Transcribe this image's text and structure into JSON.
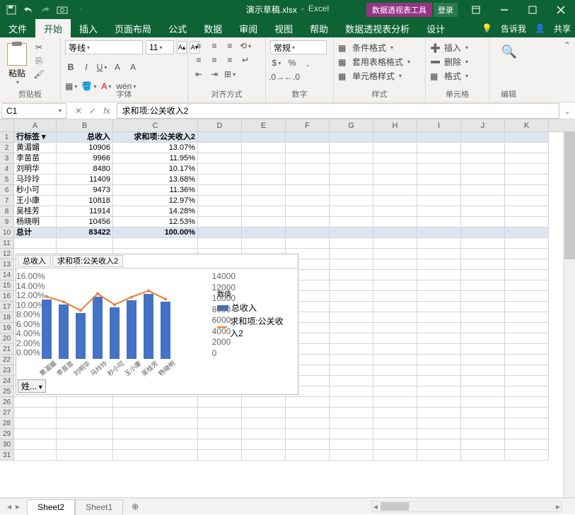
{
  "title": {
    "filename": "演示草稿.xlsx",
    "app": "Excel",
    "context_tool": "数据透视表工具",
    "login": "登录"
  },
  "tabs": {
    "file": "文件",
    "home": "开始",
    "insert": "插入",
    "layout": "页面布局",
    "formula": "公式",
    "data": "数据",
    "review": "审阅",
    "view": "视图",
    "help": "帮助",
    "pivot_analyze": "数据透视表分析",
    "design": "设计",
    "tell_me": "告诉我",
    "share": "共享"
  },
  "ribbon": {
    "clipboard": {
      "label": "剪贴板",
      "paste": "粘贴"
    },
    "font": {
      "label": "字体",
      "name": "等线",
      "size": "11"
    },
    "align": {
      "label": "对齐方式"
    },
    "number": {
      "label": "数字",
      "format": "常规"
    },
    "styles": {
      "label": "样式",
      "cond": "条件格式",
      "table": "套用表格格式",
      "cell": "单元格样式"
    },
    "cells": {
      "label": "单元格",
      "insert": "插入",
      "delete": "删除",
      "format": "格式"
    },
    "editing": {
      "label": "编辑"
    }
  },
  "formula_bar": {
    "cell_ref": "C1",
    "value": "求和项:公关收入2"
  },
  "columns": [
    "A",
    "B",
    "C",
    "D",
    "E",
    "F",
    "G",
    "H",
    "I",
    "J",
    "K"
  ],
  "pivot": {
    "headers": {
      "row": "行标签",
      "sum": "总收入",
      "calc": "求和项:公关收入2"
    },
    "rows": [
      {
        "name": "黄湄媚",
        "total": "10906",
        "pct": "13.07%"
      },
      {
        "name": "李苗苗",
        "total": "9966",
        "pct": "11.95%"
      },
      {
        "name": "刘明华",
        "total": "8480",
        "pct": "10.17%"
      },
      {
        "name": "马玲玲",
        "total": "11409",
        "pct": "13.68%"
      },
      {
        "name": "秒小可",
        "total": "9473",
        "pct": "11.36%"
      },
      {
        "name": "王小康",
        "total": "10818",
        "pct": "12.97%"
      },
      {
        "name": "吴桂芳",
        "total": "11914",
        "pct": "14.28%"
      },
      {
        "name": "杨晓明",
        "total": "10456",
        "pct": "12.53%"
      }
    ],
    "grand": {
      "label": "总计",
      "total": "83422",
      "pct": "100.00%"
    }
  },
  "chart": {
    "tabs": [
      "总收入",
      "求和项:公关收入2"
    ],
    "legend_title": "数值",
    "legend": [
      "总收入",
      "求和项:公关收入2"
    ],
    "yleft": [
      "16.00%",
      "14.00%",
      "12.00%",
      "10.00%",
      "8.00%",
      "6.00%",
      "4.00%",
      "2.00%",
      "0.00%"
    ],
    "yright": [
      "14000",
      "12000",
      "10000",
      "8000",
      "6000",
      "4000",
      "2000",
      "0"
    ],
    "categories": [
      "黄湄媚",
      "李苗苗",
      "刘明华",
      "马玲玲",
      "秒小可",
      "王小康",
      "吴桂芳",
      "杨晓明"
    ],
    "btn": "姓..."
  },
  "chart_data": {
    "type": "bar+line",
    "categories": [
      "黄湄媚",
      "李苗苗",
      "刘明华",
      "马玲玲",
      "秒小可",
      "王小康",
      "吴桂芳",
      "杨晓明"
    ],
    "series": [
      {
        "name": "总收入",
        "type": "bar",
        "axis": "right",
        "values": [
          10906,
          9966,
          8480,
          11409,
          9473,
          10818,
          11914,
          10456
        ]
      },
      {
        "name": "求和项:公关收入2",
        "type": "line",
        "axis": "left",
        "values": [
          13.07,
          11.95,
          10.17,
          13.68,
          11.36,
          12.97,
          14.28,
          12.53
        ]
      }
    ],
    "yleft_range": [
      0,
      16
    ],
    "yright_range": [
      0,
      14000
    ],
    "yleft_label": "%",
    "yright_label": ""
  },
  "sheets": {
    "active": "Sheet2",
    "other": "Sheet1"
  }
}
